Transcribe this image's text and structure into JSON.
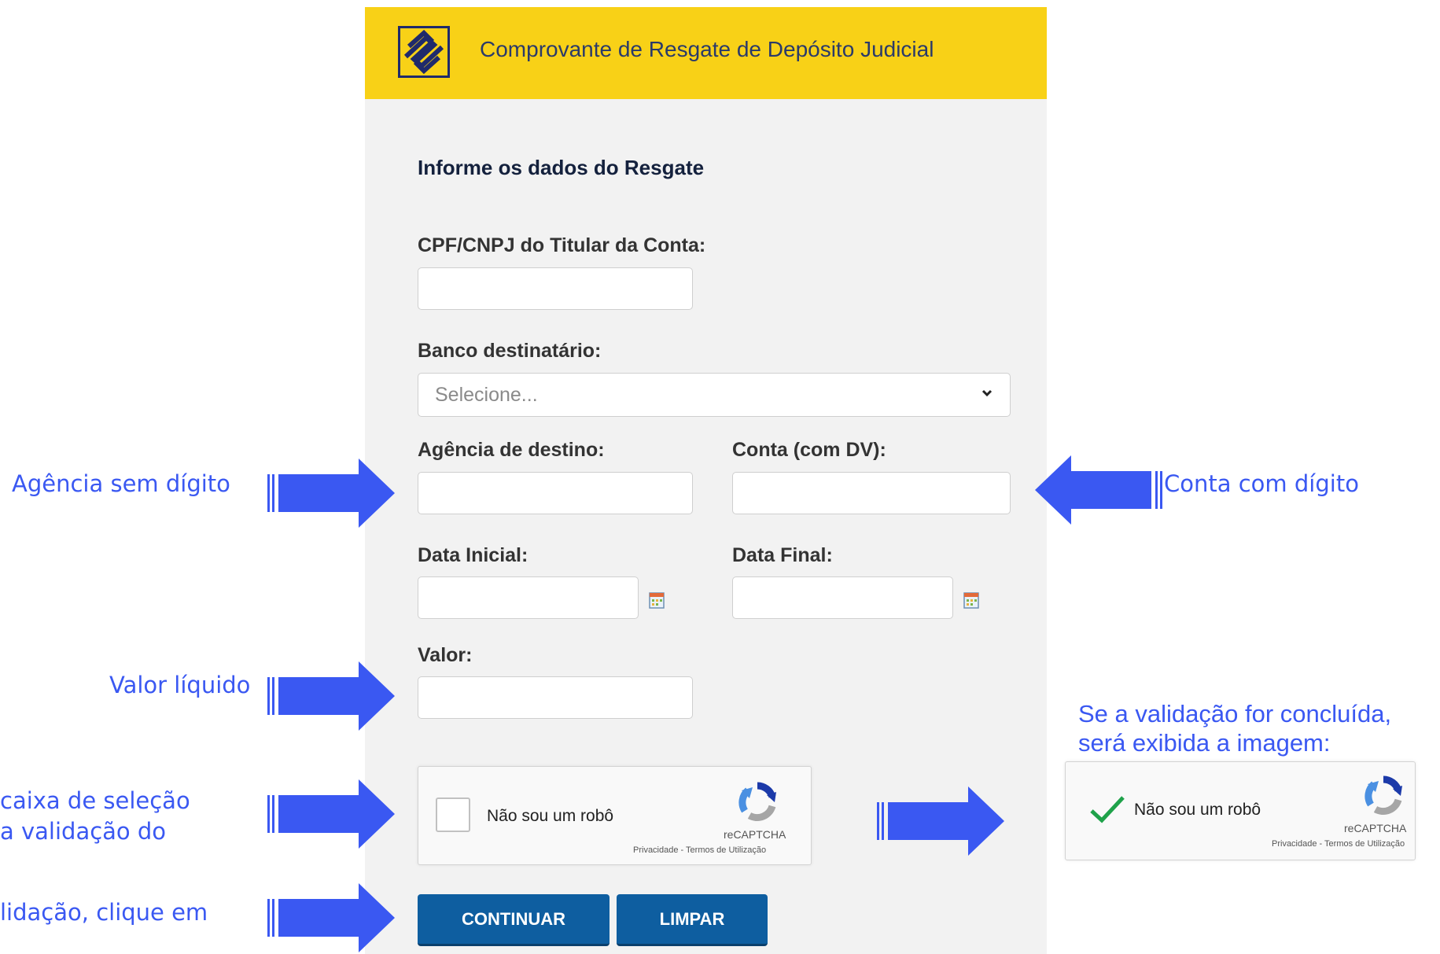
{
  "header": {
    "title": "Comprovante de Resgate de Depósito Judicial",
    "logo_icon": "banco-do-brasil-logo",
    "background": "#f8d117"
  },
  "form": {
    "section_title": "Informe os dados do Resgate",
    "cpf_label": "CPF/CNPJ do Titular da Conta:",
    "cpf_value": "",
    "banco_label": "Banco destinatário:",
    "banco_selected": "Selecione...",
    "agencia_label": "Agência de destino:",
    "agencia_value": "",
    "conta_label": "Conta (com DV):",
    "conta_value": "",
    "data_inicial_label": "Data Inicial:",
    "data_inicial_value": "",
    "data_final_label": "Data Final:",
    "data_final_value": "",
    "valor_label": "Valor:",
    "valor_value": ""
  },
  "captcha": {
    "label": "Não sou um robô",
    "brand": "reCAPTCHA",
    "links": "Privacidade - Termos de Utilização"
  },
  "captcha_validated": {
    "label": "Não sou um robô",
    "brand": "reCAPTCHA",
    "links": "Privacidade - Termos de Utilização"
  },
  "buttons": {
    "continuar": "CONTINUAR",
    "limpar": "LIMPAR",
    "color": "#0e5ea0"
  },
  "annotations": {
    "agencia": "Agência sem  dígito",
    "conta": "Conta com  dígito",
    "valor": "Valor líquido",
    "captcha_line1": "caixa de seleção",
    "captcha_line2": "a validação do",
    "continuar_line1": "lidação, clique em",
    "validated_line1": "Se a validação for concluída,",
    "validated_line2": "será exibida a imagem:",
    "color": "#3a58f2"
  }
}
